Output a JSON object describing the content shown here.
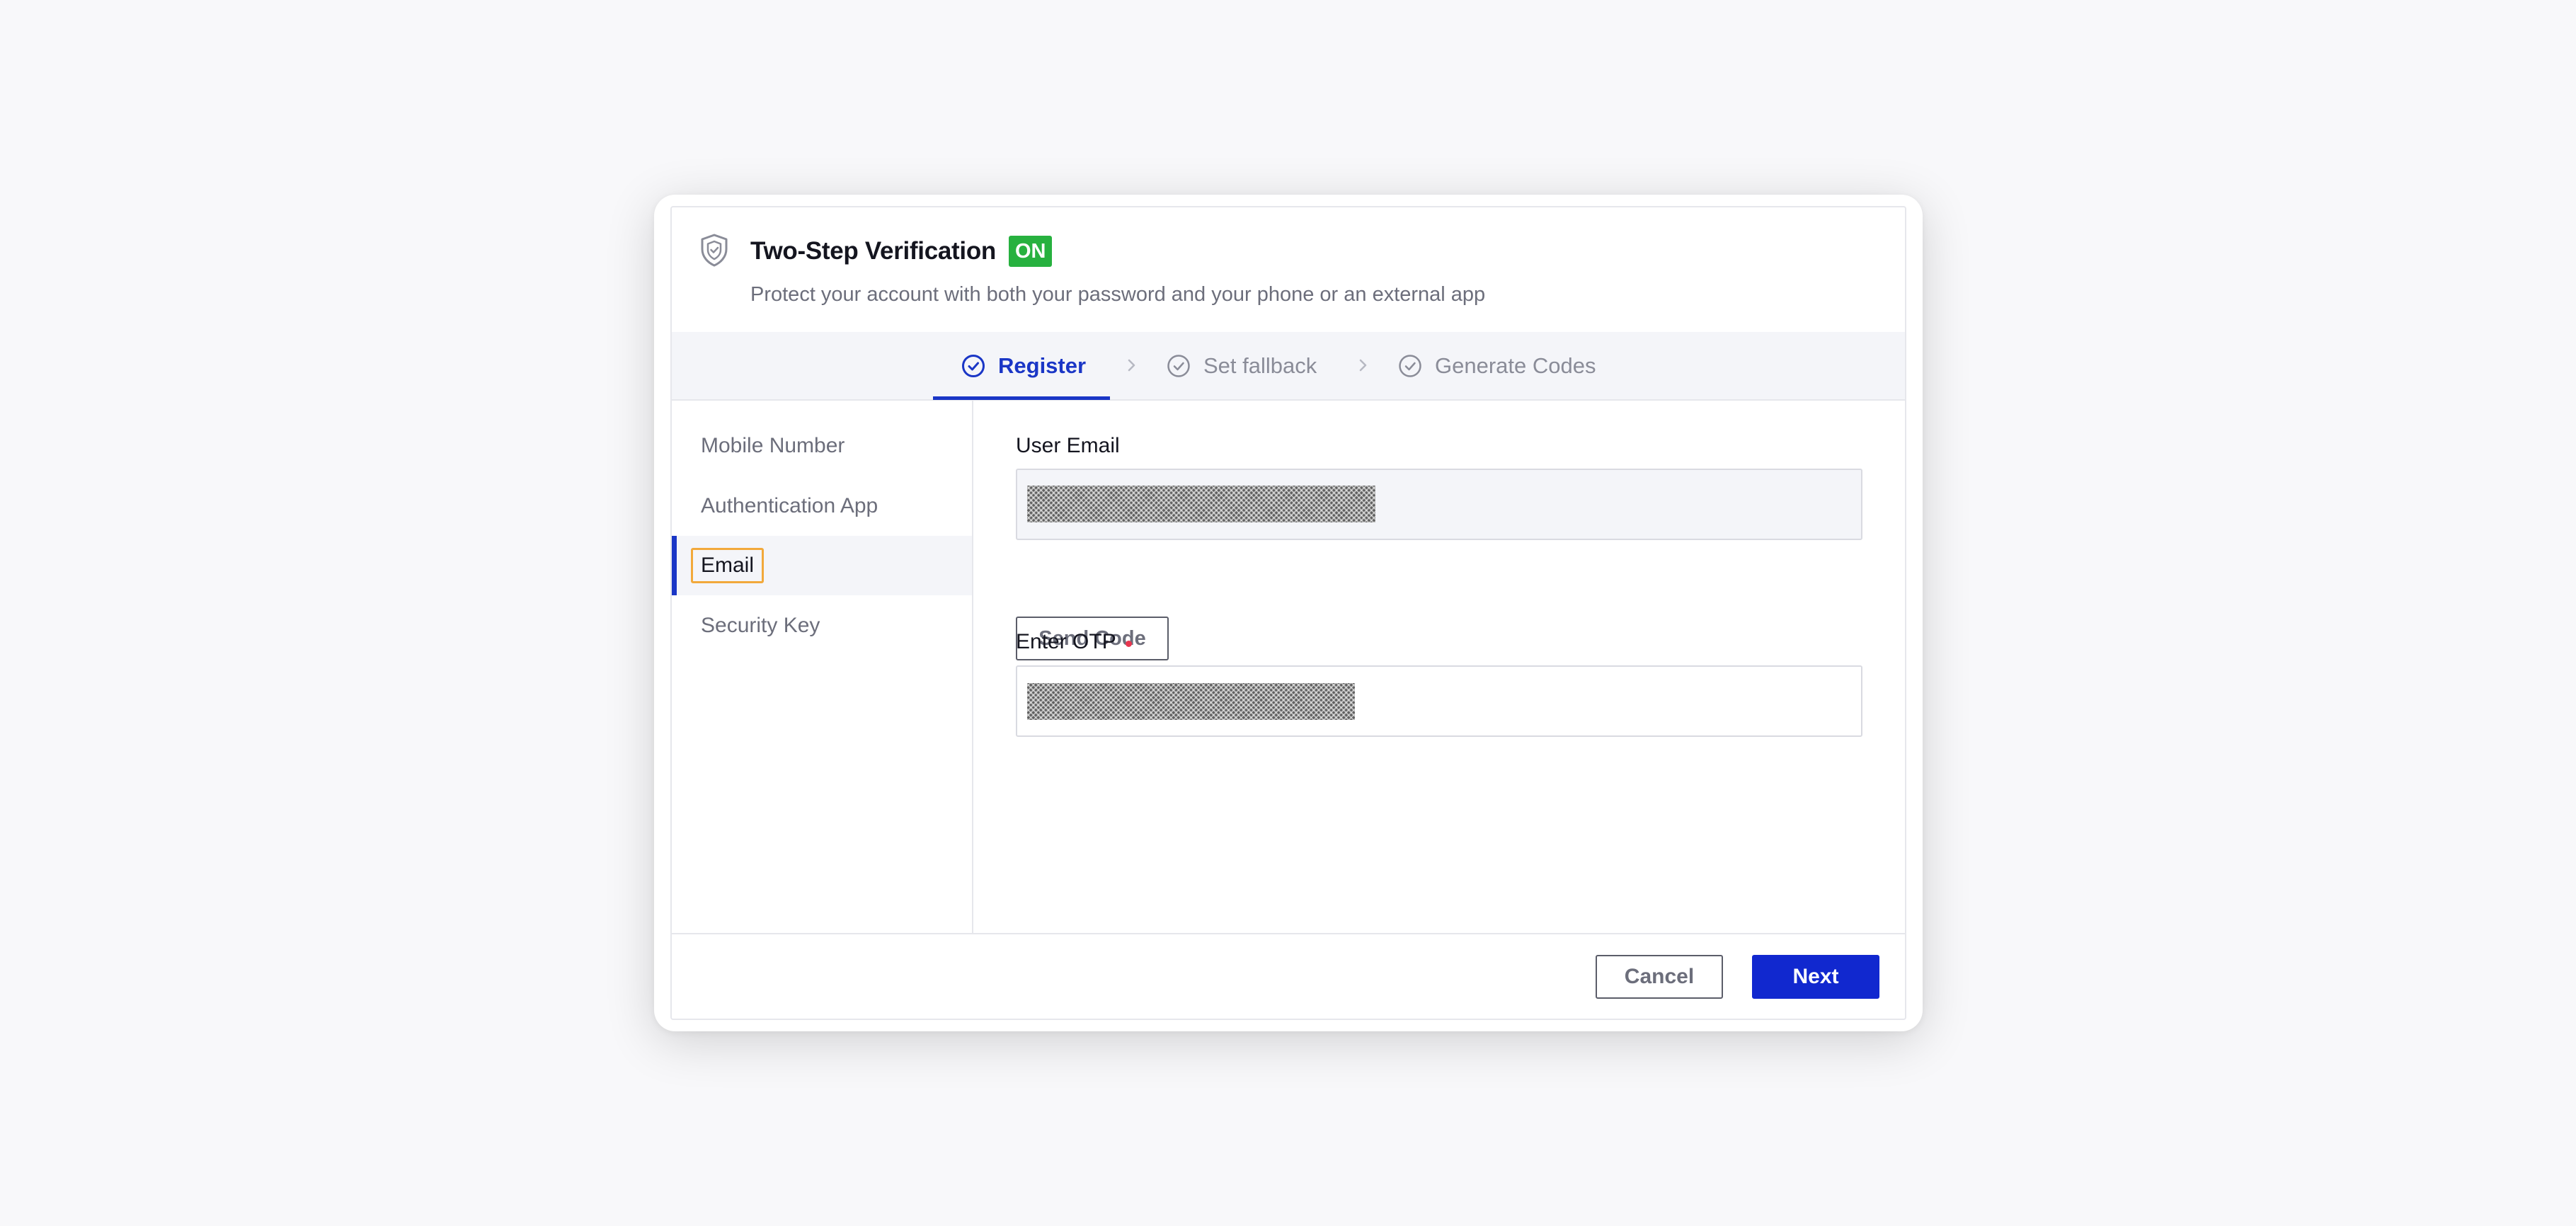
{
  "header": {
    "icon": "shield-check-icon",
    "title": "Two-Step Verification",
    "status_badge": "ON",
    "subtitle": "Protect your account with both your password and your phone or an external app"
  },
  "stepper": {
    "steps": [
      {
        "label": "Register",
        "state": "active",
        "icon": "check-circle-icon"
      },
      {
        "label": "Set fallback",
        "state": "pending",
        "icon": "check-circle-icon"
      },
      {
        "label": "Generate Codes",
        "state": "pending",
        "icon": "check-circle-icon"
      }
    ],
    "separator_icon": "chevron-right-icon"
  },
  "sidebar": {
    "items": [
      {
        "label": "Mobile Number",
        "active": false
      },
      {
        "label": "Authentication App",
        "active": false
      },
      {
        "label": "Email",
        "active": true
      },
      {
        "label": "Security Key",
        "active": false
      }
    ]
  },
  "form": {
    "email": {
      "label": "User Email",
      "value": "",
      "redacted": true
    },
    "send_code_label": "Send Code",
    "otp": {
      "label": "Enter OTP",
      "required": true,
      "value": "",
      "redacted": true
    }
  },
  "footer": {
    "cancel_label": "Cancel",
    "next_label": "Next"
  },
  "colors": {
    "accent": "#1a36c6",
    "primary_button": "#1128cf",
    "badge_on": "#27b13f",
    "focus_outline": "#f2a93b",
    "required": "#e8364f"
  }
}
